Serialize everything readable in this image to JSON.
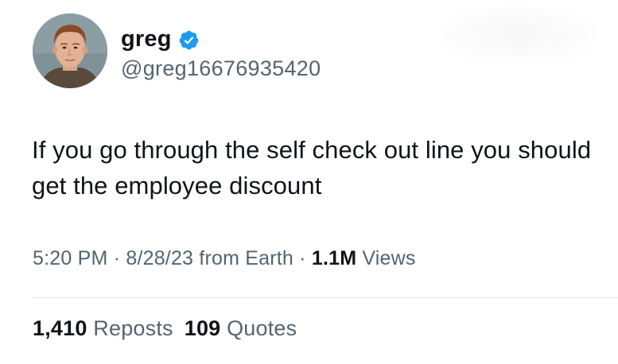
{
  "user": {
    "display_name": "greg",
    "handle": "@greg16676935420",
    "verified_icon": "verified-badge-icon",
    "verified_color": "#1d9bf0"
  },
  "tweet": {
    "text": "If you go through the self check out line you should get the employee discount"
  },
  "meta": {
    "time": "5:20 PM",
    "sep1": " · ",
    "date": "8/28/23",
    "source": " from Earth",
    "sep2": " · ",
    "views_count": "1.1M",
    "views_label": " Views"
  },
  "stats": {
    "reposts_count": "1,410",
    "reposts_label": " Reposts",
    "quotes_count": "109",
    "quotes_label": " Quotes"
  },
  "colors": {
    "text_primary": "#0f1419",
    "text_secondary": "#536471",
    "divider": "#e4e8eb"
  }
}
